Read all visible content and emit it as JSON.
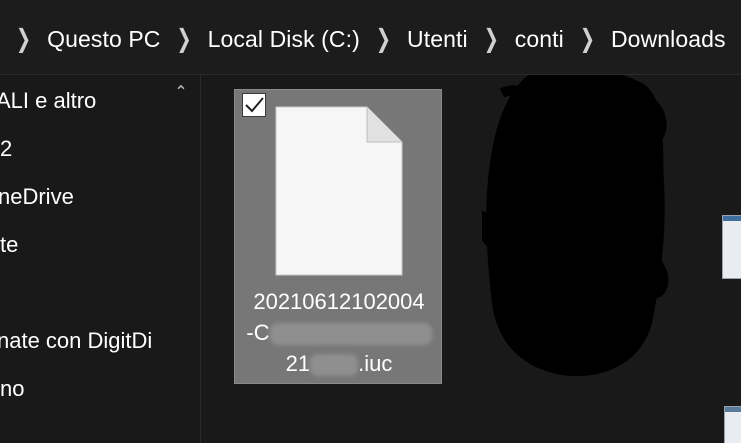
{
  "breadcrumb": {
    "items": [
      "Questo PC",
      "Local Disk (C:)",
      "Utenti",
      "conti",
      "Downloads"
    ]
  },
  "navigation": {
    "items": [
      "ALI e altro",
      "2",
      "neDrive",
      "te",
      "",
      "nate con DigitDi",
      "no"
    ]
  },
  "file": {
    "name_line1": "20210612102004",
    "name_line2_prefix": "-C",
    "name_line2_suffix": "",
    "name_line3_prefix": "21",
    "name_line3_suffix": ".iuc",
    "selected": true
  },
  "colors": {
    "background": "#191919",
    "tile_selected": "#777777",
    "text": "#ffffff"
  },
  "icons": {
    "chevron": "chevron-right-icon",
    "file": "document-icon",
    "scroll": "chevron-up-icon"
  }
}
